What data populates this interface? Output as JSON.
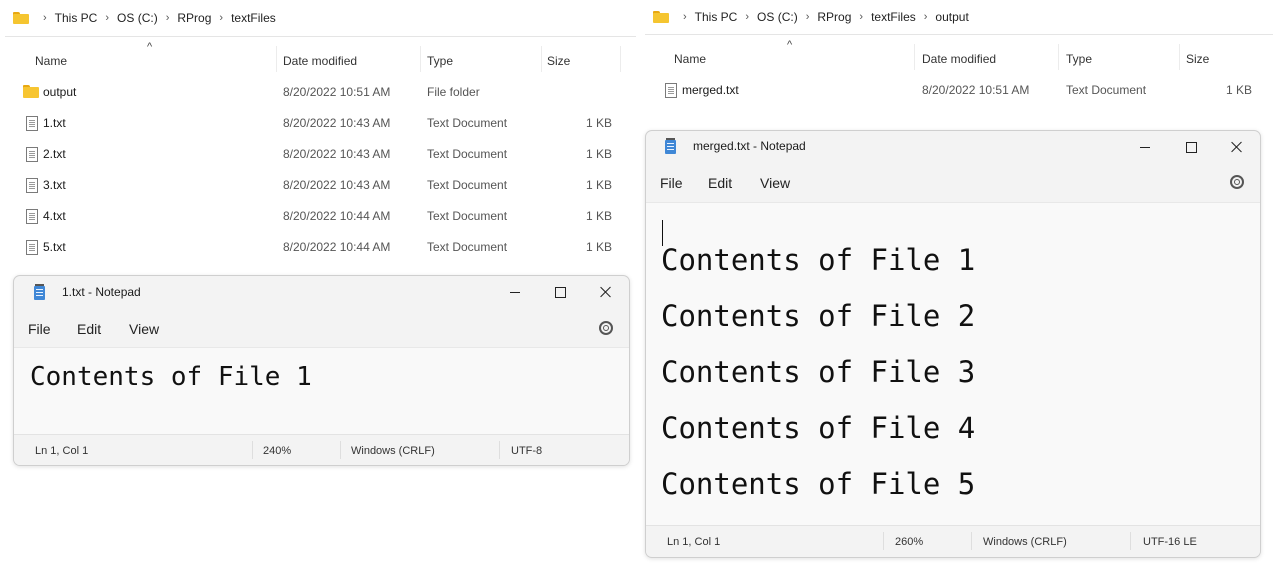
{
  "left_explorer": {
    "breadcrumb": [
      "This PC",
      "OS (C:)",
      "RProg",
      "textFiles"
    ],
    "columns": {
      "name": "Name",
      "date": "Date modified",
      "type": "Type",
      "size": "Size"
    },
    "rows": [
      {
        "icon": "folder-icon",
        "name": "output",
        "date": "8/20/2022 10:51 AM",
        "type": "File folder",
        "size": ""
      },
      {
        "icon": "text-file-icon",
        "name": "1.txt",
        "date": "8/20/2022 10:43 AM",
        "type": "Text Document",
        "size": "1 KB"
      },
      {
        "icon": "text-file-icon",
        "name": "2.txt",
        "date": "8/20/2022 10:43 AM",
        "type": "Text Document",
        "size": "1 KB"
      },
      {
        "icon": "text-file-icon",
        "name": "3.txt",
        "date": "8/20/2022 10:43 AM",
        "type": "Text Document",
        "size": "1 KB"
      },
      {
        "icon": "text-file-icon",
        "name": "4.txt",
        "date": "8/20/2022 10:44 AM",
        "type": "Text Document",
        "size": "1 KB"
      },
      {
        "icon": "text-file-icon",
        "name": "5.txt",
        "date": "8/20/2022 10:44 AM",
        "type": "Text Document",
        "size": "1 KB"
      }
    ]
  },
  "right_explorer": {
    "breadcrumb": [
      "This PC",
      "OS (C:)",
      "RProg",
      "textFiles",
      "output"
    ],
    "columns": {
      "name": "Name",
      "date": "Date modified",
      "type": "Type",
      "size": "Size"
    },
    "rows": [
      {
        "icon": "text-file-icon",
        "name": "merged.txt",
        "date": "8/20/2022 10:51 AM",
        "type": "Text Document",
        "size": "1 KB"
      }
    ]
  },
  "notepad_left": {
    "title": "1.txt - Notepad",
    "menu": [
      "File",
      "Edit",
      "View"
    ],
    "lines": [
      "Contents of File 1"
    ],
    "status": {
      "position": "Ln 1, Col 1",
      "zoom": "240%",
      "line_ending": "Windows (CRLF)",
      "encoding": "UTF-8"
    }
  },
  "notepad_right": {
    "title": "merged.txt - Notepad",
    "menu": [
      "File",
      "Edit",
      "View"
    ],
    "lines": [
      "Contents of File 1",
      "Contents of File 2",
      "Contents of File 3",
      "Contents of File 4",
      "Contents of File 5"
    ],
    "status": {
      "position": "Ln 1, Col 1",
      "zoom": "260%",
      "line_ending": "Windows (CRLF)",
      "encoding": "UTF-16 LE"
    }
  },
  "colors": {
    "folder": "#f7c531",
    "notepad_icon": "#3f87d6",
    "window_bg": "#f3f3f3",
    "editor_bg": "#f9f9f9"
  }
}
